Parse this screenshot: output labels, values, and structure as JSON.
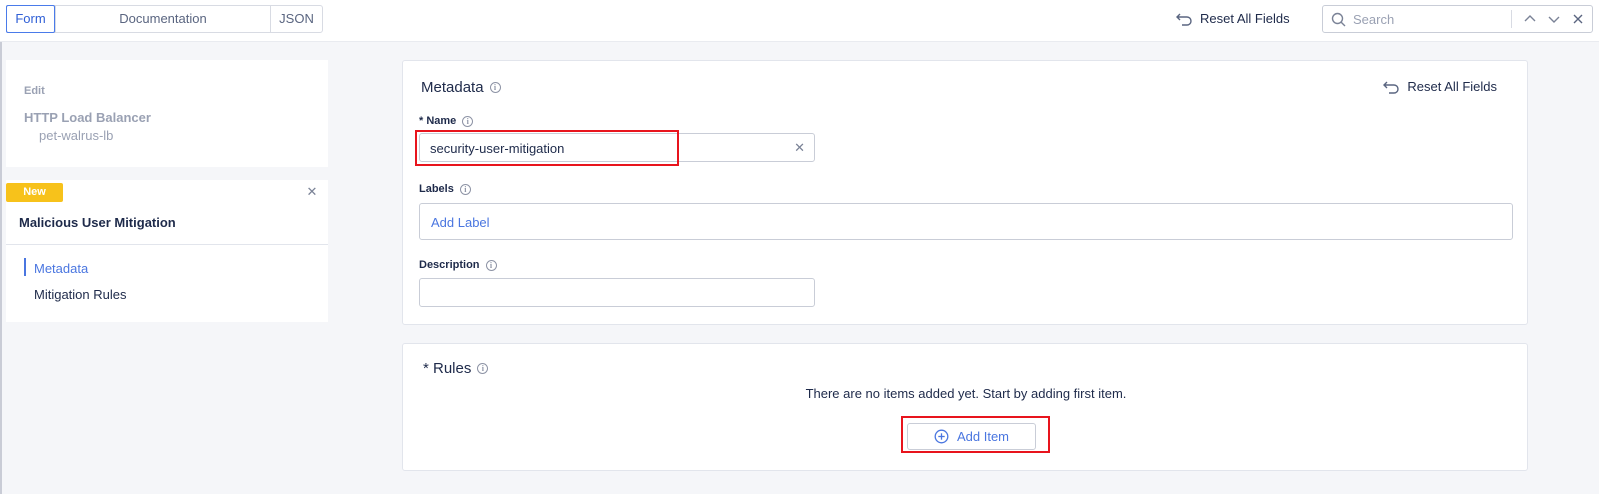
{
  "topbar": {
    "tabs": [
      {
        "label": "Form",
        "active": true
      },
      {
        "label": "Documentation",
        "active": false
      },
      {
        "label": "JSON",
        "active": false
      }
    ],
    "reset_label": "Reset All Fields",
    "search_placeholder": "Search"
  },
  "sidebar": {
    "edit_card": {
      "label": "Edit",
      "title": "HTTP Load Balancer",
      "subtitle": "pet-walrus-lb"
    },
    "new_card": {
      "badge": "New",
      "title": "Malicious User Mitigation",
      "nav": [
        {
          "label": "Metadata",
          "active": true
        },
        {
          "label": "Mitigation Rules",
          "active": false
        }
      ]
    }
  },
  "metadata_panel": {
    "title": "Metadata",
    "reset_label": "Reset All Fields",
    "name_label": "* Name",
    "name_value": "security-user-mitigation",
    "labels_label": "Labels",
    "labels_placeholder": "Add Label",
    "description_label": "Description",
    "description_value": ""
  },
  "rules_panel": {
    "title": "* Rules",
    "empty_text": "There are no items added yet. Start by adding first item.",
    "add_button_label": "Add Item"
  },
  "colors": {
    "accent": "#4a76e0",
    "badge": "#f7c21b",
    "highlight": "#e8141d",
    "text": "#1e2a4a"
  },
  "icons": [
    "reset-icon",
    "search-icon",
    "chevron-up-icon",
    "chevron-down-icon",
    "close-icon",
    "info-icon",
    "plus-circle-icon"
  ]
}
